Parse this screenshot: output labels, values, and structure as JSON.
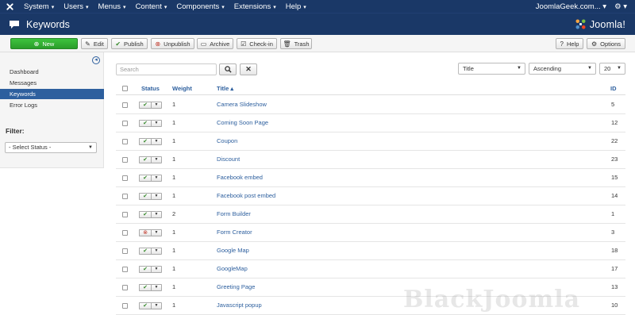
{
  "topnav": {
    "menus": [
      "System",
      "Users",
      "Menus",
      "Content",
      "Components",
      "Extensions",
      "Help"
    ],
    "site_name": "JoomlaGeek.com..."
  },
  "titlebar": {
    "title": "Keywords",
    "brand": "Joomla!"
  },
  "toolbar": {
    "new": "New",
    "edit": "Edit",
    "publish": "Publish",
    "unpublish": "Unpublish",
    "archive": "Archive",
    "checkin": "Check-in",
    "trash": "Trash",
    "help": "Help",
    "options": "Options"
  },
  "sidebar": {
    "items": [
      "Dashboard",
      "Messages",
      "Keywords",
      "Error Logs"
    ],
    "active": "Keywords",
    "filter_label": "Filter:",
    "status_select": "- Select Status -"
  },
  "search": {
    "placeholder": "Search"
  },
  "sort": {
    "field": "Title",
    "direction": "Ascending",
    "limit": "20"
  },
  "table": {
    "headers": {
      "status": "Status",
      "weight": "Weight",
      "title": "Title",
      "title_sort_indicator": "▴",
      "id": "ID"
    },
    "rows": [
      {
        "status": "published",
        "weight": "1",
        "title": "Camera Slideshow",
        "id": "5"
      },
      {
        "status": "published",
        "weight": "1",
        "title": "Coming Soon Page",
        "id": "12"
      },
      {
        "status": "published",
        "weight": "1",
        "title": "Coupon",
        "id": "22"
      },
      {
        "status": "published",
        "weight": "1",
        "title": "Discount",
        "id": "23"
      },
      {
        "status": "published",
        "weight": "1",
        "title": "Facebook embed",
        "id": "15"
      },
      {
        "status": "published",
        "weight": "1",
        "title": "Facebook post embed",
        "id": "14"
      },
      {
        "status": "published",
        "weight": "2",
        "title": "Form Builder",
        "id": "1"
      },
      {
        "status": "unpublished",
        "weight": "1",
        "title": "Form Creator",
        "id": "3"
      },
      {
        "status": "published",
        "weight": "1",
        "title": "Google Map",
        "id": "18"
      },
      {
        "status": "published",
        "weight": "1",
        "title": "GoogleMap",
        "id": "17"
      },
      {
        "status": "published",
        "weight": "1",
        "title": "Greeting Page",
        "id": "13"
      },
      {
        "status": "published",
        "weight": "1",
        "title": "Javascript popup",
        "id": "10"
      }
    ]
  },
  "watermark": "BlackJoomla",
  "colors": {
    "nav_bg": "#1a3867",
    "accent": "#2d5f9e",
    "new_button": "#2fa32f",
    "published": "#3a8b2f",
    "unpublished": "#c0392b"
  }
}
